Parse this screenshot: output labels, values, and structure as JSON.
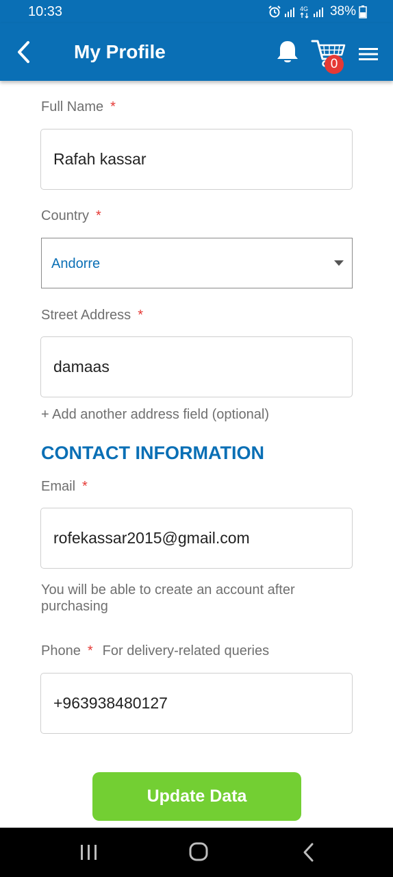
{
  "status_bar": {
    "time": "10:33",
    "battery": "38%",
    "network": "4G"
  },
  "app_bar": {
    "title": "My Profile",
    "cart_count": "0",
    "color": "#0a6fb5"
  },
  "form": {
    "full_name": {
      "label": "Full Name",
      "required": "*",
      "value": "Rafah kassar"
    },
    "country": {
      "label": "Country",
      "required": "*",
      "value": "Andorre"
    },
    "street_address": {
      "label": "Street Address",
      "required": "*",
      "value": "damaas"
    },
    "add_address_link": "+ Add another address field (optional)",
    "contact_section_title": "CONTACT INFORMATION",
    "email": {
      "label": "Email",
      "required": "*",
      "value": "rofekassar2015@gmail.com"
    },
    "account_note": "You will be able to create an account after purchasing",
    "phone": {
      "label": "Phone",
      "required": "*",
      "note": "For delivery-related queries",
      "value": "+963938480127"
    }
  },
  "actions": {
    "update_label": "Update Data",
    "update_color": "#73cf33"
  },
  "icons": {
    "back": "arrow-left-icon",
    "notifications": "bell-icon",
    "cart": "cart-icon",
    "menu": "hamburger-menu-icon"
  }
}
